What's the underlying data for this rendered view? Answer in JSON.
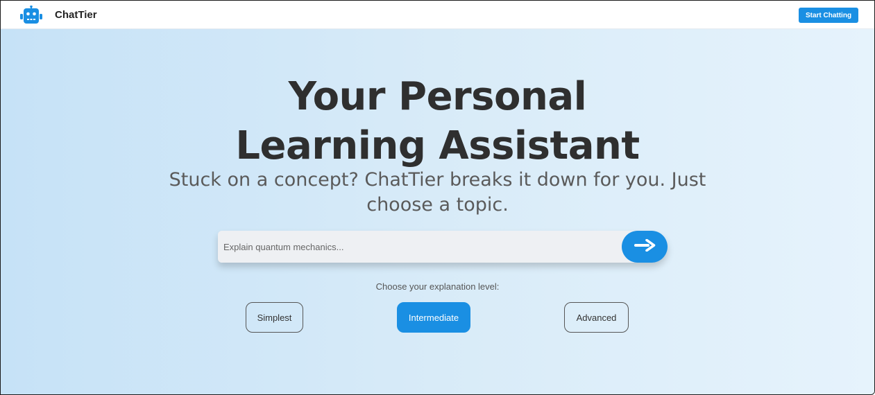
{
  "app": {
    "brand": "ChatTier",
    "logo_icon": "robot-icon",
    "accent_color": "#1a8fe3"
  },
  "navbar": {
    "start_button_label": "Start Chatting"
  },
  "hero": {
    "title": "Your Personal Learning Assistant",
    "subtitle": "Stuck on a concept? ChatTier breaks it down for you. Just choose a topic."
  },
  "search": {
    "placeholder": "Explain quantum mechanics...",
    "value": "",
    "submit_icon": "arrow-right-icon"
  },
  "levels": {
    "label": "Choose your explanation level:",
    "options": [
      {
        "label": "Simplest",
        "selected": false
      },
      {
        "label": "Intermediate",
        "selected": true
      },
      {
        "label": "Advanced",
        "selected": false
      }
    ]
  }
}
